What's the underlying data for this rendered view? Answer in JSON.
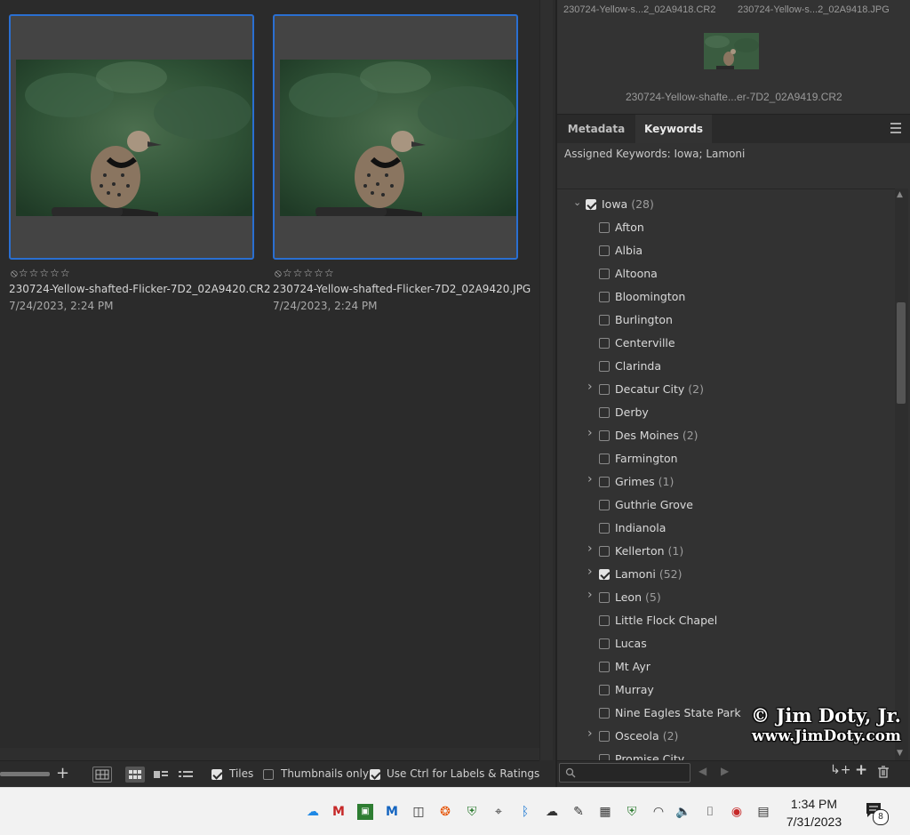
{
  "thumbnails": [
    {
      "filename": "230724-Yellow-shafted-Flicker-7D2_02A9420.CR2",
      "date": "7/24/2023, 2:24 PM",
      "rating": "⦸☆☆☆☆☆"
    },
    {
      "filename": "230724-Yellow-shafted-Flicker-7D2_02A9420.JPG",
      "date": "7/24/2023, 2:24 PM",
      "rating": "⦸☆☆☆☆☆"
    }
  ],
  "preview": {
    "names_top": [
      "230724-Yellow-s...2_02A9418.CR2",
      "230724-Yellow-s...2_02A9418.JPG"
    ],
    "name_bottom": "230724-Yellow-shafte...er-7D2_02A9419.CR2"
  },
  "tabs": [
    {
      "label": "Metadata",
      "active": false
    },
    {
      "label": "Keywords",
      "active": true
    }
  ],
  "assigned_keywords": "Assigned Keywords: Iowa; Lamoni",
  "keywords_root": {
    "label": "Iowa",
    "count": "(28)",
    "checked": true,
    "expanded": true
  },
  "keywords": [
    {
      "label": "Afton",
      "count": "",
      "checked": false,
      "has_children": false
    },
    {
      "label": "Albia",
      "count": "",
      "checked": false,
      "has_children": false
    },
    {
      "label": "Altoona",
      "count": "",
      "checked": false,
      "has_children": false
    },
    {
      "label": "Bloomington",
      "count": "",
      "checked": false,
      "has_children": false
    },
    {
      "label": "Burlington",
      "count": "",
      "checked": false,
      "has_children": false
    },
    {
      "label": "Centerville",
      "count": "",
      "checked": false,
      "has_children": false
    },
    {
      "label": "Clarinda",
      "count": "",
      "checked": false,
      "has_children": false
    },
    {
      "label": "Decatur City",
      "count": "(2)",
      "checked": false,
      "has_children": true
    },
    {
      "label": "Derby",
      "count": "",
      "checked": false,
      "has_children": false
    },
    {
      "label": "Des Moines",
      "count": "(2)",
      "checked": false,
      "has_children": true
    },
    {
      "label": "Farmington",
      "count": "",
      "checked": false,
      "has_children": false
    },
    {
      "label": "Grimes",
      "count": "(1)",
      "checked": false,
      "has_children": true
    },
    {
      "label": "Guthrie Grove",
      "count": "",
      "checked": false,
      "has_children": false
    },
    {
      "label": "Indianola",
      "count": "",
      "checked": false,
      "has_children": false
    },
    {
      "label": "Kellerton",
      "count": "(1)",
      "checked": false,
      "has_children": true
    },
    {
      "label": "Lamoni",
      "count": "(52)",
      "checked": true,
      "has_children": true
    },
    {
      "label": "Leon",
      "count": "(5)",
      "checked": false,
      "has_children": true
    },
    {
      "label": "Little Flock Chapel",
      "count": "",
      "checked": false,
      "has_children": false
    },
    {
      "label": "Lucas",
      "count": "",
      "checked": false,
      "has_children": false
    },
    {
      "label": "Mt Ayr",
      "count": "",
      "checked": false,
      "has_children": false
    },
    {
      "label": "Murray",
      "count": "",
      "checked": false,
      "has_children": false
    },
    {
      "label": "Nine Eagles State Park",
      "count": "",
      "checked": false,
      "has_children": false
    },
    {
      "label": "Osceola",
      "count": "(2)",
      "checked": false,
      "has_children": true
    },
    {
      "label": "Promise City",
      "count": "",
      "checked": false,
      "has_children": false
    }
  ],
  "watermark": {
    "line1": "© Jim Doty, Jr.",
    "line2": "www.JimDoty.com"
  },
  "footer": {
    "tiles_label": "Tiles",
    "tiles_checked": true,
    "thumbs_only_label": "Thumbnails only",
    "thumbs_only_checked": false,
    "ctrl_label": "Use Ctrl for Labels & Ratings",
    "ctrl_checked": true
  },
  "taskbar": {
    "time": "1:34 PM",
    "date": "7/31/2023",
    "notifications": "8"
  },
  "colors": {
    "selection_border": "#2a6fd1",
    "panel_bg": "#323232",
    "content_bg": "#2b2b2b"
  }
}
